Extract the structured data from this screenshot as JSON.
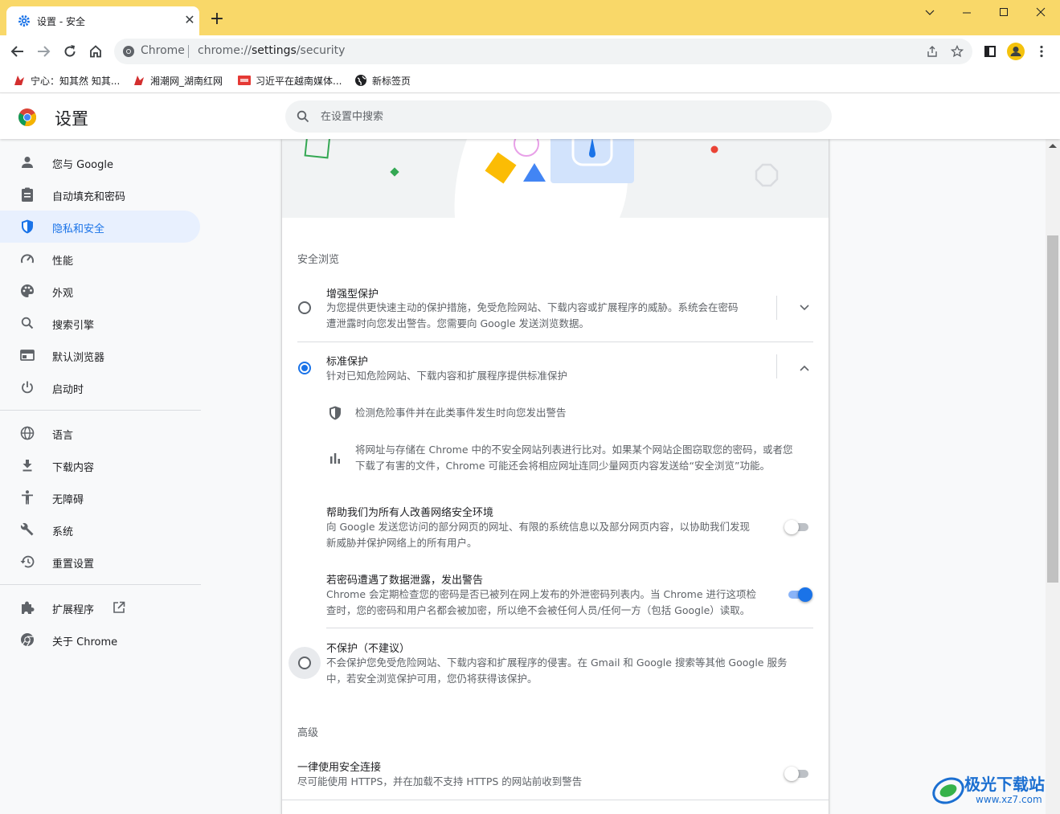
{
  "colors": {
    "accent": "#1a73e8",
    "tabbar": "#f9d869",
    "active_nav_bg": "#e8f0fe"
  },
  "tab": {
    "title": "设置 - 安全",
    "favicon": "gear-icon"
  },
  "window": {
    "minimize": "minimize-icon",
    "maximize": "maximize-icon",
    "close": "close-icon"
  },
  "omnibox": {
    "label": "Chrome",
    "url_prefix": "chrome://",
    "url_path": "settings",
    "url_suffix": "/security"
  },
  "bookmarks": [
    {
      "label": "宁心：知其然 知其..."
    },
    {
      "label": "湘潮网_湖南红网"
    },
    {
      "label": "习近平在越南媒体..."
    },
    {
      "label": "新标签页"
    }
  ],
  "header": {
    "title": "设置",
    "search_placeholder": "在设置中搜索"
  },
  "sidebar": {
    "items": [
      {
        "label": "您与 Google",
        "icon": "person-icon"
      },
      {
        "label": "自动填充和密码",
        "icon": "clipboard-icon"
      },
      {
        "label": "隐私和安全",
        "icon": "shield-icon",
        "active": true
      },
      {
        "label": "性能",
        "icon": "speedometer-icon"
      },
      {
        "label": "外观",
        "icon": "palette-icon"
      },
      {
        "label": "搜索引擎",
        "icon": "search-icon"
      },
      {
        "label": "默认浏览器",
        "icon": "browser-icon"
      },
      {
        "label": "启动时",
        "icon": "power-icon"
      },
      {
        "label": "语言",
        "icon": "globe-icon"
      },
      {
        "label": "下载内容",
        "icon": "download-icon"
      },
      {
        "label": "无障碍",
        "icon": "accessibility-icon"
      },
      {
        "label": "系统",
        "icon": "wrench-icon"
      },
      {
        "label": "重置设置",
        "icon": "history-icon"
      },
      {
        "label": "扩展程序",
        "icon": "puzzle-icon"
      },
      {
        "label": "关于 Chrome",
        "icon": "chrome-icon"
      }
    ]
  },
  "safe_browsing": {
    "heading": "安全浏览",
    "enhanced": {
      "title": "增强型保护",
      "desc_line1": "为您提供更快速主动的保护措施，免受危险网站、下载内容或扩展程序的威胁。系统会在密码",
      "desc_line2": "遭泄露时向您发出警告。您需要向 Google 发送浏览数据。"
    },
    "standard": {
      "title": "标准保护",
      "desc": "针对已知危险网站、下载内容和扩展程序提供标准保护",
      "detail1": "检测危险事件并在此类事件发生时向您发出警告",
      "detail2_line1": "将网址与存储在 Chrome 中的不安全网站列表进行比对。如果某个网站企图窃取您的密码，或者您",
      "detail2_line2": "下载了有害的文件，Chrome 可能还会将相应网址连同少量网页内容发送给“安全浏览”功能。"
    },
    "help_improve": {
      "title": "帮助我们为所有人改善网络安全环境",
      "desc_line1": "向 Google 发送您访问的部分网页的网址、有限的系统信息以及部分网页内容，以协助我们发现",
      "desc_line2": "新威胁并保护网络上的所有用户。",
      "enabled": false
    },
    "password_warn": {
      "title": "若密码遭遇了数据泄露，发出警告",
      "desc_line1": "Chrome 会定期检查您的密码是否已被列在网上发布的外泄密码列表内。当 Chrome 进行这项检",
      "desc_line2": "查时，您的密码和用户名都会被加密，所以绝不会被任何人员/任何一方（包括 Google）读取。",
      "enabled": true
    },
    "no_protection": {
      "title": "不保护（不建议）",
      "desc_line1": "不会保护您免受危险网站、下载内容和扩展程序的侵害。在 Gmail 和 Google 搜索等其他 Google 服务",
      "desc_line2": "中，若安全浏览保护可用，您仍将获得该保护。"
    }
  },
  "advanced": {
    "heading": "高级",
    "https": {
      "title": "一律使用安全连接",
      "desc": "尽可能使用 HTTPS，并在加载不支持 HTTPS 的网站前收到警告",
      "enabled": false
    }
  },
  "watermark": {
    "text": "极光下载站",
    "url": "www.xz7.com"
  }
}
